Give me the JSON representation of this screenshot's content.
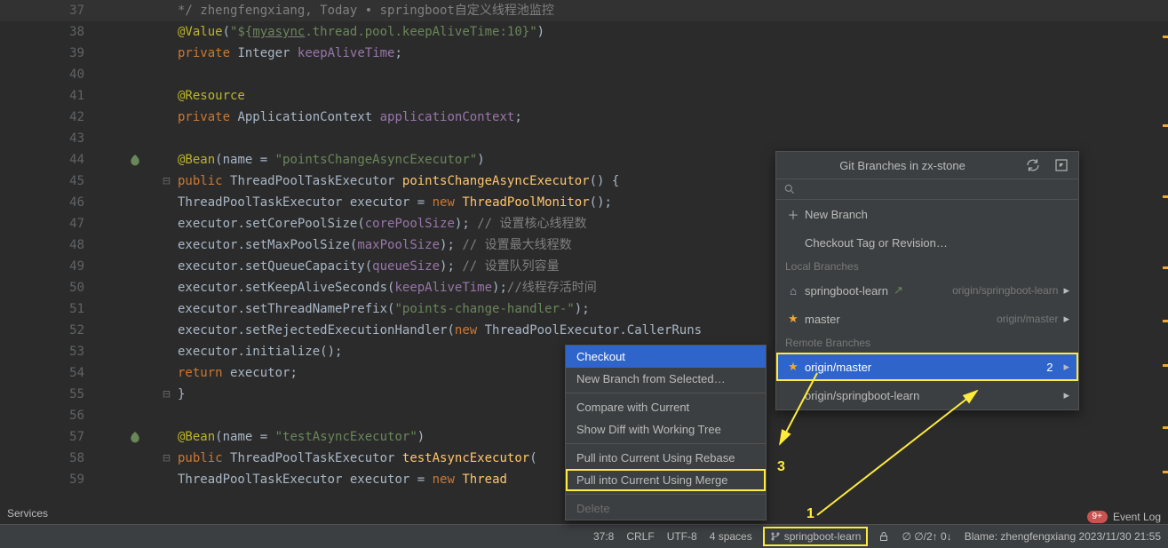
{
  "editor": {
    "lines": [
      {
        "num": "37",
        "hl": true,
        "fold": "",
        "html": "<span class='cmt'>*/   zhengfengxiang, Today • springboot自定义线程池监控</span>"
      },
      {
        "num": "38",
        "fold": "",
        "html": "<span class='ann'>@Value</span><span class='pun'>(</span><span class='str'>\"${</span><span class='str underl'>myasync</span><span class='str'>.thread.pool.keepAliveTime:10}\"</span><span class='pun'>)</span>"
      },
      {
        "num": "39",
        "fold": "",
        "html": "<span class='kw'>private</span> <span class='id'>Integer</span> <span class='fld'>keepAliveTime</span><span class='pun'>;</span>"
      },
      {
        "num": "40",
        "fold": "",
        "html": ""
      },
      {
        "num": "41",
        "fold": "",
        "html": "<span class='ann'>@Resource</span>"
      },
      {
        "num": "42",
        "fold": "",
        "html": "<span class='kw'>private</span> <span class='id'>ApplicationContext</span> <span class='fld'>applicationContext</span><span class='pun'>;</span>"
      },
      {
        "num": "43",
        "fold": "",
        "html": ""
      },
      {
        "num": "44",
        "fold": "",
        "mark": "leaf",
        "html": "<span class='ann'>@Bean</span><span class='pun'>(</span><span class='id'>name = </span><span class='str'>\"pointsChangeAsyncExecutor\"</span><span class='pun'>)</span>"
      },
      {
        "num": "45",
        "fold": "⊟",
        "html": "<span class='kw'>public</span> <span class='id'>ThreadPoolTaskExecutor</span> <span class='type'>pointsChangeAsyncExecutor</span><span class='pun'>() {</span>"
      },
      {
        "num": "46",
        "fold": "",
        "html": "    <span class='id'>ThreadPoolTaskExecutor</span> <span class='id'>executor</span> <span class='pun'>=</span> <span class='kw'>new</span> <span class='type'>ThreadPoolMonitor</span><span class='pun'>();</span>"
      },
      {
        "num": "47",
        "fold": "",
        "html": "    <span class='id'>executor</span><span class='dot'>.</span><span class='id'>setCorePoolSize</span><span class='pun'>(</span><span class='fld'>corePoolSize</span><span class='pun'>);</span> <span class='cmt'>// 设置核心线程数</span>"
      },
      {
        "num": "48",
        "fold": "",
        "html": "    <span class='id'>executor</span><span class='dot'>.</span><span class='id'>setMaxPoolSize</span><span class='pun'>(</span><span class='fld'>maxPoolSize</span><span class='pun'>);</span> <span class='cmt'>// 设置最大线程数</span>"
      },
      {
        "num": "49",
        "fold": "",
        "html": "    <span class='id'>executor</span><span class='dot'>.</span><span class='id'>setQueueCapacity</span><span class='pun'>(</span><span class='fld'>queueSize</span><span class='pun'>);</span> <span class='cmt'>// 设置队列容量</span>"
      },
      {
        "num": "50",
        "fold": "",
        "html": "    <span class='id'>executor</span><span class='dot'>.</span><span class='id'>setKeepAliveSeconds</span><span class='pun'>(</span><span class='fld'>keepAliveTime</span><span class='pun'>);</span><span class='cmt'>//线程存活时间</span>"
      },
      {
        "num": "51",
        "fold": "",
        "html": "    <span class='id'>executor</span><span class='dot'>.</span><span class='id'>setThreadNamePrefix</span><span class='pun'>(</span><span class='str'>\"points-change-handler-\"</span><span class='pun'>);</span>"
      },
      {
        "num": "52",
        "fold": "",
        "html": "    <span class='id'>executor</span><span class='dot'>.</span><span class='id'>setRejectedExecutionHandler</span><span class='pun'>(</span><span class='kw'>new</span> <span class='id'>ThreadPoolExecutor</span><span class='dot'>.</span><span class='id'>CallerRuns</span>"
      },
      {
        "num": "53",
        "fold": "",
        "html": "    <span class='id'>executor</span><span class='dot'>.</span><span class='id'>initialize</span><span class='pun'>();</span>"
      },
      {
        "num": "54",
        "fold": "",
        "html": "    <span class='kw'>return</span> <span class='id'>executor</span><span class='pun'>;</span>"
      },
      {
        "num": "55",
        "fold": "⊟",
        "html": "<span class='pun'>}</span>"
      },
      {
        "num": "56",
        "fold": "",
        "html": ""
      },
      {
        "num": "57",
        "fold": "",
        "mark": "leaf",
        "html": "<span class='ann'>@Bean</span><span class='pun'>(</span><span class='id'>name = </span><span class='str'>\"testAsyncExecutor\"</span><span class='pun'>)</span>"
      },
      {
        "num": "58",
        "fold": "⊟",
        "html": "<span class='kw'>public</span> <span class='id'>ThreadPoolTaskExecutor</span> <span class='type'>testAsyncExecutor</span><span class='pun'>(</span>"
      },
      {
        "num": "59",
        "fold": "",
        "html": "    <span class='id'>ThreadPoolTaskExecutor</span> <span class='id'>executor</span> <span class='pun'>=</span> <span class='kw'>new</span> <span class='type'>Thread</span>"
      }
    ],
    "base_indent": "    "
  },
  "branches": {
    "title": "Git Branches in zx-stone",
    "new_branch": "New Branch",
    "checkout_tag": "Checkout Tag or Revision…",
    "local_header": "Local Branches",
    "remote_header": "Remote Branches",
    "local": [
      {
        "name": "springboot-learn",
        "track": "origin/springboot-learn",
        "icon": "tag",
        "extra": "↗"
      },
      {
        "name": "master",
        "track": "origin/master",
        "icon": "star"
      }
    ],
    "remote": [
      {
        "name": "origin/master",
        "selected": true,
        "icon": "star"
      },
      {
        "name": "origin/springboot-learn",
        "icon": ""
      }
    ]
  },
  "ctx": {
    "items": [
      {
        "label": "Checkout",
        "sel": true
      },
      {
        "label": "New Branch from Selected…"
      },
      {
        "sep": true
      },
      {
        "label": "Compare with Current"
      },
      {
        "label": "Show Diff with Working Tree"
      },
      {
        "sep": true
      },
      {
        "label": "Pull into Current Using Rebase"
      },
      {
        "label": "Pull into Current Using Merge",
        "box": true
      },
      {
        "sep": true
      },
      {
        "label": "Delete",
        "disabled": true
      }
    ]
  },
  "status": {
    "caret": "37:8",
    "line_sep": "CRLF",
    "encoding": "UTF-8",
    "indent": "4 spaces",
    "branch": "springboot-learn",
    "behind": "∅ ∅/2↑ 0↓",
    "blame": "Blame: zhengfengxiang 2023/11/30 21:55"
  },
  "services_label": "Services",
  "event_log": {
    "badge": "9+",
    "label": "Event Log"
  },
  "annotations": {
    "n1": "1",
    "n2": "2",
    "n3": "3"
  }
}
